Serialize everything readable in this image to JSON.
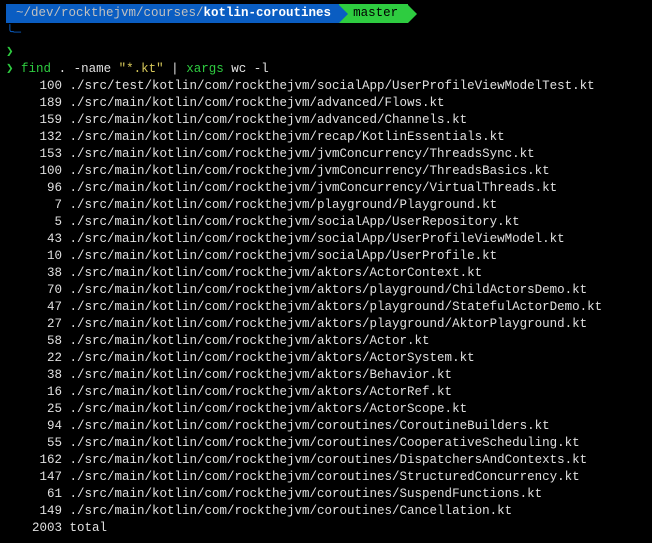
{
  "prompt": {
    "path_prefix": "~/dev/rockthejvm/courses/",
    "path_bold": "kotlin-coroutines",
    "branch": "master",
    "continuation_glyph": "╰─"
  },
  "command": {
    "prompt_char": "❯",
    "cmd1": "find",
    "arg1": ".",
    "flag1": "-name",
    "str1": "\"*.kt\"",
    "pipe": "|",
    "cmd2": "xargs",
    "cmd3": "wc",
    "flag2": "-l"
  },
  "output": [
    {
      "count": "100",
      "path": "./src/test/kotlin/com/rockthejvm/socialApp/UserProfileViewModelTest.kt"
    },
    {
      "count": "189",
      "path": "./src/main/kotlin/com/rockthejvm/advanced/Flows.kt"
    },
    {
      "count": "159",
      "path": "./src/main/kotlin/com/rockthejvm/advanced/Channels.kt"
    },
    {
      "count": "132",
      "path": "./src/main/kotlin/com/rockthejvm/recap/KotlinEssentials.kt"
    },
    {
      "count": "153",
      "path": "./src/main/kotlin/com/rockthejvm/jvmConcurrency/ThreadsSync.kt"
    },
    {
      "count": "100",
      "path": "./src/main/kotlin/com/rockthejvm/jvmConcurrency/ThreadsBasics.kt"
    },
    {
      "count": "96",
      "path": "./src/main/kotlin/com/rockthejvm/jvmConcurrency/VirtualThreads.kt"
    },
    {
      "count": "7",
      "path": "./src/main/kotlin/com/rockthejvm/playground/Playground.kt"
    },
    {
      "count": "5",
      "path": "./src/main/kotlin/com/rockthejvm/socialApp/UserRepository.kt"
    },
    {
      "count": "43",
      "path": "./src/main/kotlin/com/rockthejvm/socialApp/UserProfileViewModel.kt"
    },
    {
      "count": "10",
      "path": "./src/main/kotlin/com/rockthejvm/socialApp/UserProfile.kt"
    },
    {
      "count": "38",
      "path": "./src/main/kotlin/com/rockthejvm/aktors/ActorContext.kt"
    },
    {
      "count": "70",
      "path": "./src/main/kotlin/com/rockthejvm/aktors/playground/ChildActorsDemo.kt"
    },
    {
      "count": "47",
      "path": "./src/main/kotlin/com/rockthejvm/aktors/playground/StatefulActorDemo.kt"
    },
    {
      "count": "27",
      "path": "./src/main/kotlin/com/rockthejvm/aktors/playground/AktorPlayground.kt"
    },
    {
      "count": "58",
      "path": "./src/main/kotlin/com/rockthejvm/aktors/Actor.kt"
    },
    {
      "count": "22",
      "path": "./src/main/kotlin/com/rockthejvm/aktors/ActorSystem.kt"
    },
    {
      "count": "38",
      "path": "./src/main/kotlin/com/rockthejvm/aktors/Behavior.kt"
    },
    {
      "count": "16",
      "path": "./src/main/kotlin/com/rockthejvm/aktors/ActorRef.kt"
    },
    {
      "count": "25",
      "path": "./src/main/kotlin/com/rockthejvm/aktors/ActorScope.kt"
    },
    {
      "count": "94",
      "path": "./src/main/kotlin/com/rockthejvm/coroutines/CoroutineBuilders.kt"
    },
    {
      "count": "55",
      "path": "./src/main/kotlin/com/rockthejvm/coroutines/CooperativeScheduling.kt"
    },
    {
      "count": "162",
      "path": "./src/main/kotlin/com/rockthejvm/coroutines/DispatchersAndContexts.kt"
    },
    {
      "count": "147",
      "path": "./src/main/kotlin/com/rockthejvm/coroutines/StructuredConcurrency.kt"
    },
    {
      "count": "61",
      "path": "./src/main/kotlin/com/rockthejvm/coroutines/SuspendFunctions.kt"
    },
    {
      "count": "149",
      "path": "./src/main/kotlin/com/rockthejvm/coroutines/Cancellation.kt"
    }
  ],
  "total": {
    "count": "2003",
    "label": "total"
  }
}
